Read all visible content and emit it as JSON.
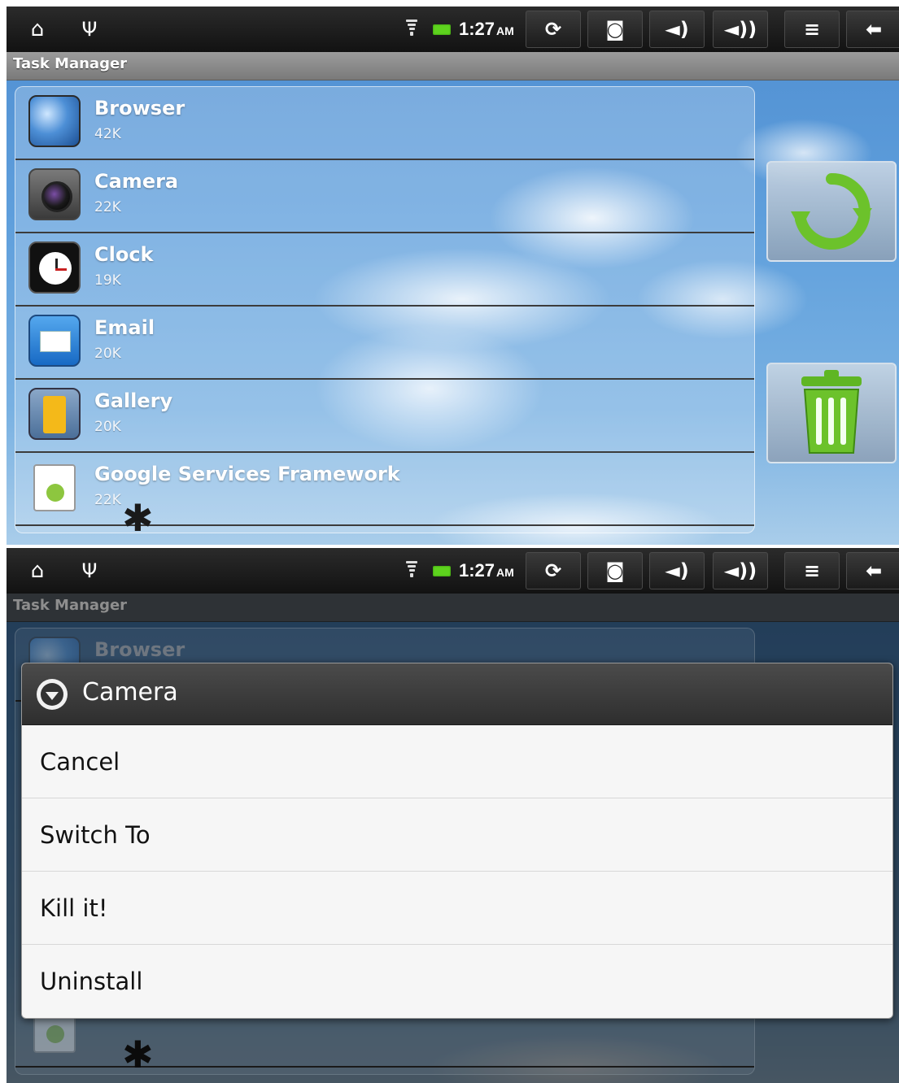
{
  "statusbar": {
    "time": "1:27",
    "ampm": "AM",
    "icons": {
      "home": "home-icon",
      "usb": "usb-icon",
      "wifi": "wifi-icon",
      "battery": "battery-icon",
      "sync": "sync-icon",
      "camera": "screenshot-camera-icon",
      "vol_down": "volume-down-icon",
      "vol_up": "volume-up-icon",
      "menu": "menu-icon",
      "back": "back-icon"
    },
    "glyphs": {
      "home": "⌂",
      "usb": "Ψ",
      "sync": "⟳",
      "camera": "◙",
      "vol_down": "◄)",
      "vol_up": "◄))",
      "menu": "≡",
      "back": "⬅"
    }
  },
  "title": "Task Manager",
  "tasks": [
    {
      "name": "Browser",
      "size": "42K",
      "icon": "browser-icon"
    },
    {
      "name": "Camera",
      "size": "22K",
      "icon": "camera-icon"
    },
    {
      "name": "Clock",
      "size": "19K",
      "icon": "clock-icon"
    },
    {
      "name": "Email",
      "size": "20K",
      "icon": "email-icon"
    },
    {
      "name": "Gallery",
      "size": "20K",
      "icon": "gallery-icon"
    },
    {
      "name": "Google Services Framework",
      "size": "22K",
      "icon": "android-icon"
    }
  ],
  "side_buttons": {
    "refresh": "refresh-icon",
    "trash": "trash-icon",
    "accent": "#6cc22b"
  },
  "dialog": {
    "title": "Camera",
    "items": [
      "Cancel",
      "Switch To",
      "Kill it!",
      "Uninstall"
    ]
  },
  "colors": {
    "statusbar": "#1b1b1b",
    "title_bar": "#8a8a8a",
    "battery": "#5ed31e",
    "dialog_bg": "#f6f6f6",
    "dialog_head": "#3a3a3a"
  }
}
